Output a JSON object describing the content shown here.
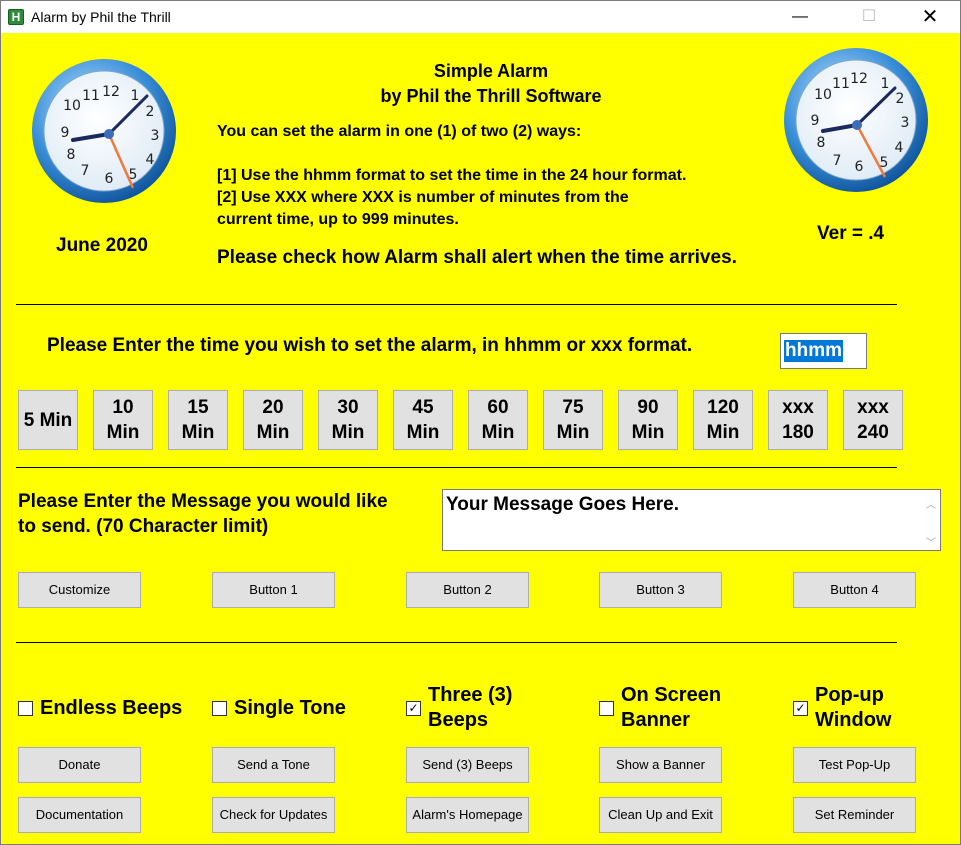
{
  "window": {
    "title": "Alarm by Phil the Thrill",
    "icon_letter": "H",
    "controls": {
      "minimize": "—",
      "maximize": "☐",
      "close": "✕"
    }
  },
  "header": {
    "app_name": "Simple Alarm",
    "author": "by Phil the Thrill Software",
    "intro": "You can set the alarm in one (1) of two (2) ways:",
    "option1": "[1] Use the hhmm format to set the time in the 24 hour format.",
    "option2_line1": "[2] Use XXX where XXX is number of minutes from the",
    "option2_line2": "current time, up to 999 minutes.",
    "alert_prompt": "Please check how Alarm shall alert when the time arrives.",
    "date": "June 2020",
    "version": "Ver = .4"
  },
  "time_entry": {
    "prompt": "Please Enter the time you wish to set the alarm, in hhmm or xxx format.",
    "value": "hhmm"
  },
  "time_buttons": [
    "5 Min",
    "10\nMin",
    "15\nMin",
    "20\nMin",
    "30\nMin",
    "45\nMin",
    "60\nMin",
    "75\nMin",
    "90\nMin",
    "120\nMin",
    "xxx\n180",
    "xxx\n240"
  ],
  "message": {
    "prompt_line1": "Please Enter the Message you would like",
    "prompt_line2": "to send.  (70 Character limit)",
    "value": "Your Message Goes Here."
  },
  "custom_buttons": [
    "Customize",
    "Button 1",
    "Button 2",
    "Button 3",
    "Button 4"
  ],
  "alerts": [
    {
      "label": "Endless Beeps",
      "checked": false
    },
    {
      "label": "Single Tone",
      "checked": false
    },
    {
      "label": "Three (3)\nBeeps",
      "checked": true
    },
    {
      "label": "On Screen\nBanner",
      "checked": false
    },
    {
      "label": "Pop-up\nWindow",
      "checked": true
    }
  ],
  "action_row1": [
    "Donate",
    "Send a Tone",
    "Send (3) Beeps",
    "Show a Banner",
    "Test Pop-Up"
  ],
  "action_row2": [
    "Documentation",
    "Check for Updates",
    "Alarm's Homepage",
    "Clean Up and Exit",
    "Set Reminder"
  ],
  "check_mark": "✓"
}
